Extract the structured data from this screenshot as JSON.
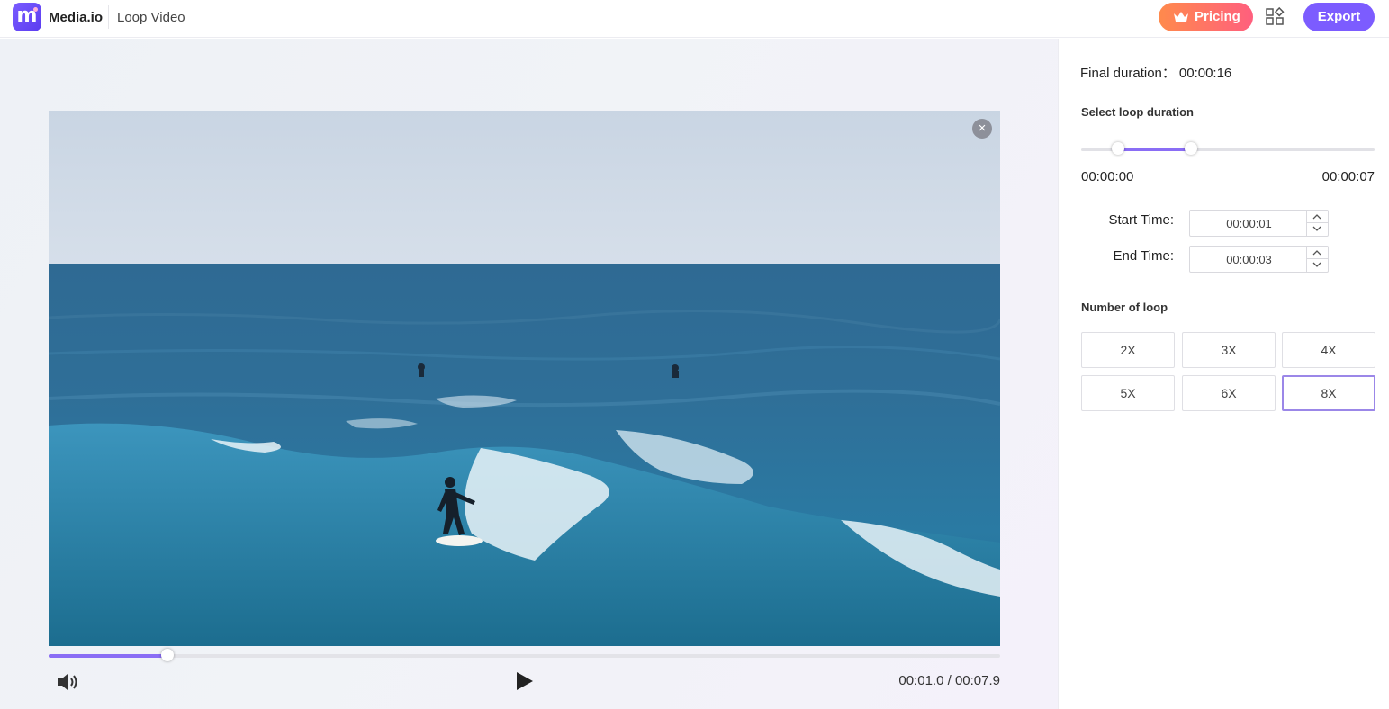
{
  "header": {
    "brand": "Media.io",
    "page_title": "Loop Video",
    "pricing_label": "Pricing",
    "export_label": "Export"
  },
  "player": {
    "time_readout": "00:01.0 / 00:07.9",
    "progress": 0.125,
    "close_label": "×"
  },
  "panel": {
    "final_duration_label": "Final duration：",
    "final_duration_value": "00:00:16",
    "select_loop_title": "Select loop duration",
    "range_min_label": "00:00:00",
    "range_max_label": "00:00:07",
    "range_start": 0.125,
    "range_end": 0.375,
    "start_time_label": "Start Time:",
    "start_time_value": "00:00:01",
    "end_time_label": "End Time:",
    "end_time_value": "00:00:03",
    "loop_title": "Number of loop",
    "loop_options": [
      "2X",
      "3X",
      "4X",
      "5X",
      "6X",
      "8X"
    ],
    "selected_loop": "8X"
  },
  "colors": {
    "accent": "#7c5cff",
    "pricing_start": "#ff8a4c",
    "pricing_end": "#ff5f7e"
  }
}
